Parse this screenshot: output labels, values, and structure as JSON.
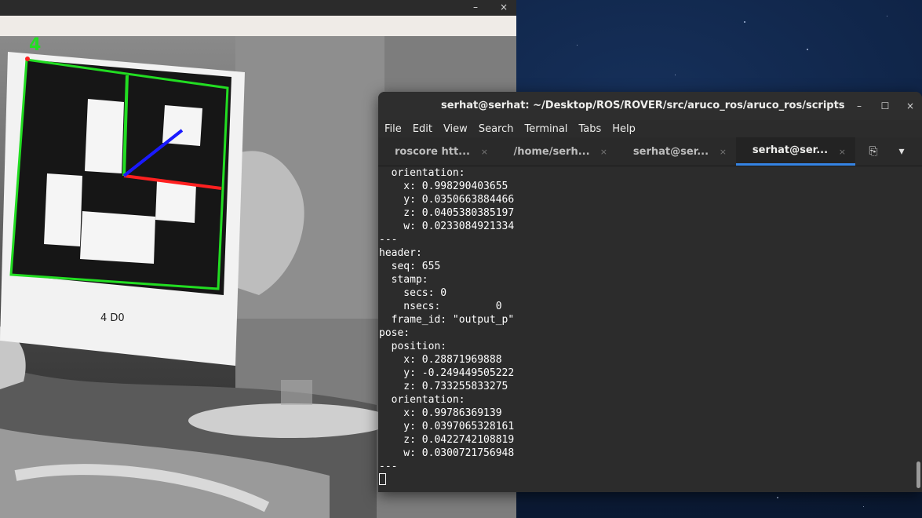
{
  "camera_window": {
    "controls": {
      "minimize": "–",
      "close": "×"
    },
    "marker_id_label": "4",
    "paper_caption": "4 D0",
    "axis_colors": {
      "x": "#ff2020",
      "y": "#22dd22",
      "z": "#1a1aff"
    },
    "outline_color": "#22dd22"
  },
  "terminal": {
    "title": "serhat@serhat: ~/Desktop/ROS/ROVER/src/aruco_ros/aruco_ros/scripts",
    "window_buttons": {
      "minimize": "–",
      "maximize": "☐",
      "close": "×"
    },
    "menu": [
      "File",
      "Edit",
      "View",
      "Search",
      "Terminal",
      "Tabs",
      "Help"
    ],
    "tabs": [
      {
        "label": "roscore htt...",
        "active": false
      },
      {
        "label": "/home/serh...",
        "active": false
      },
      {
        "label": "serhat@ser...",
        "active": false
      },
      {
        "label": "serhat@ser...",
        "active": true
      }
    ],
    "tab_close": "×",
    "new_tab_icon": "⎘",
    "tab_menu_icon": "▾",
    "output_lines": [
      "  orientation:",
      "    x: 0.998290403655",
      "    y: 0.0350663884466",
      "    z: 0.0405380385197",
      "    w: 0.0233084921334",
      "---",
      "header:",
      "  seq: 655",
      "  stamp:",
      "    secs: 0",
      "    nsecs:         0",
      "  frame_id: \"output_p\"",
      "pose:",
      "  position:",
      "    x: 0.28871969888",
      "    y: -0.249449505222",
      "    z: 0.733255833275",
      "  orientation:",
      "    x: 0.99786369139",
      "    y: 0.0397065328161",
      "    z: 0.0422742108819",
      "    w: 0.0300721756948",
      "---"
    ]
  }
}
